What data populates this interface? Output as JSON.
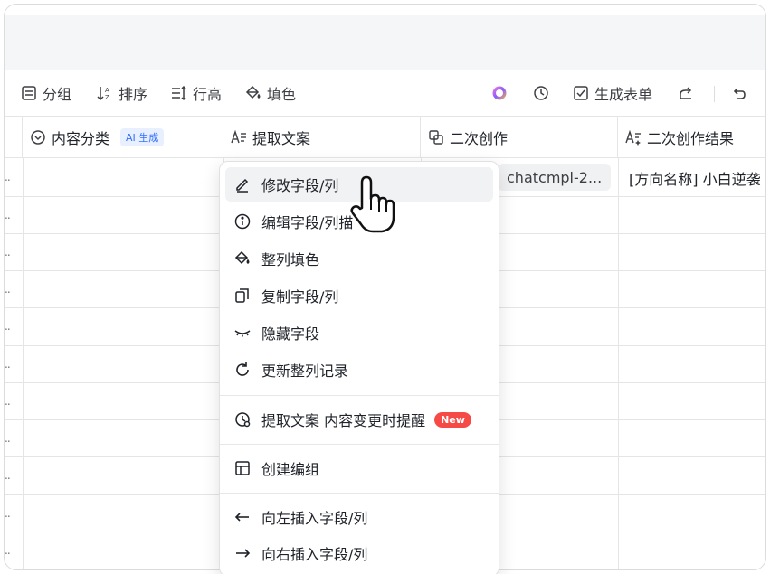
{
  "toolbar": {
    "group_label": "分组",
    "sort_label": "排序",
    "row_height_label": "行高",
    "fill_label": "填色",
    "generate_form_label": "生成表单"
  },
  "columns": {
    "col1": {
      "label": "内容分类",
      "badge": "AI 生成"
    },
    "col2": {
      "label": "提取文案"
    },
    "col3": {
      "label": "二次创作"
    },
    "col4": {
      "label": "二次创作结果"
    }
  },
  "row1": {
    "chip_text": "chatcmpl-2...",
    "result_text": "[方向名称] 小白逆袭"
  },
  "row_dots": "..",
  "menu": {
    "edit_field": "修改字段/列",
    "edit_desc": "编辑字段/列描",
    "fill_column": "整列填色",
    "copy_field": "复制字段/列",
    "hide_field": "隐藏字段",
    "refresh_records": "更新整列记录",
    "notify": "提取文案 内容变更时提醒",
    "notify_badge": "New",
    "create_group": "创建编组",
    "insert_left": "向左插入字段/列",
    "insert_right": "向右插入字段/列"
  }
}
